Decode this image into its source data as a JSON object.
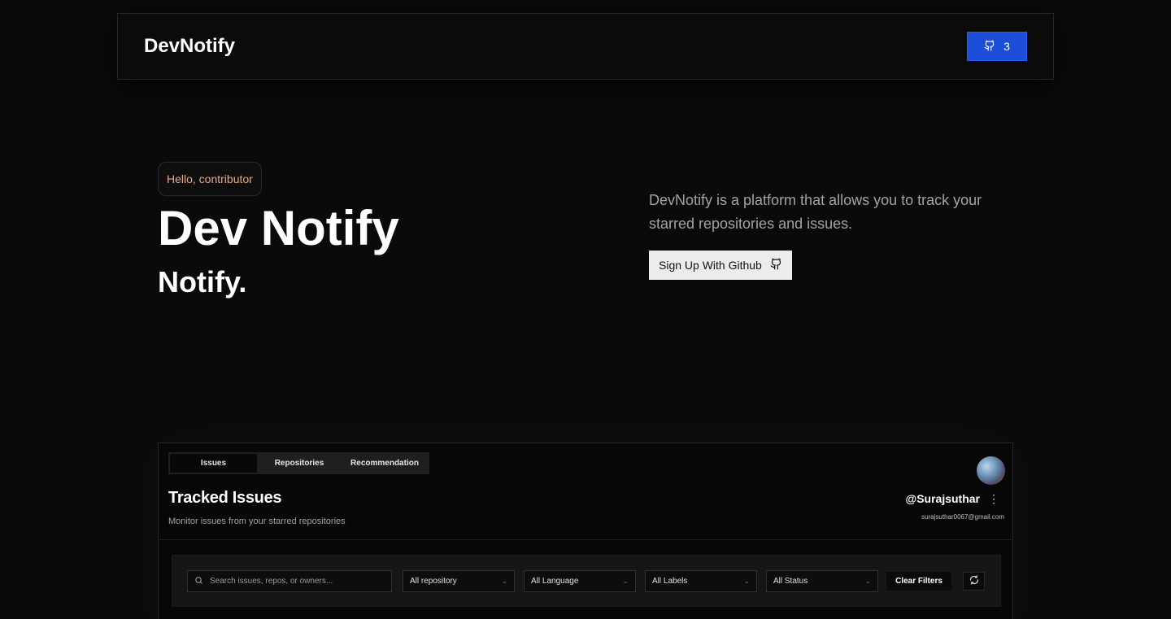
{
  "nav": {
    "brand": "DevNotify",
    "star_count": "3",
    "star_icon": "github-icon"
  },
  "hero": {
    "badge": "Hello, contributor",
    "title": "Dev Notify",
    "subtitle": "Notify.",
    "description": "DevNotify is a platform that allows you to track your starred repositories and issues.",
    "signup_label": "Sign Up With Github",
    "signup_icon": "github-icon"
  },
  "preview": {
    "tabs": [
      {
        "label": "Issues",
        "active": true
      },
      {
        "label": "Repositories",
        "active": false
      },
      {
        "label": "Recommendation",
        "active": false
      }
    ],
    "title": "Tracked Issues",
    "subtitle": "Monitor issues from your starred repositories",
    "username": "@Surajsuthar",
    "email": "surajsuthar0067@gmail.com",
    "search_placeholder": "Search issues, repos, or owners...",
    "filters": [
      {
        "label": "All repository"
      },
      {
        "label": "All Language"
      },
      {
        "label": "All Labels"
      },
      {
        "label": "All Status"
      }
    ],
    "clear_label": "Clear Filters"
  },
  "colors": {
    "background": "#0a0a0a",
    "accent_blue": "#1d4ed8",
    "badge_text": "#e8a88a"
  }
}
